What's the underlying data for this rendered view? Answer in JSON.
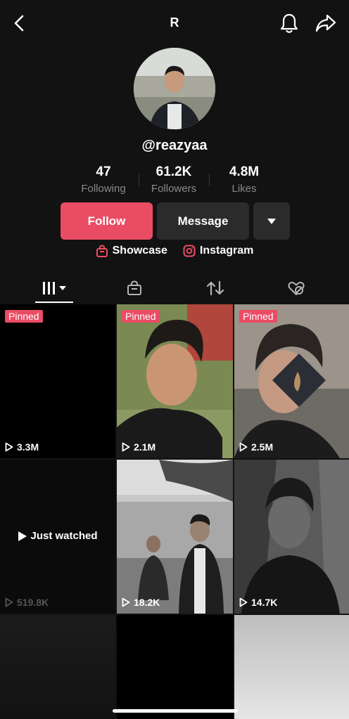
{
  "header": {
    "title": "R"
  },
  "profile": {
    "handle": "@reazyaa",
    "stats": [
      {
        "value": "47",
        "label": "Following"
      },
      {
        "value": "61.2K",
        "label": "Followers"
      },
      {
        "value": "4.8M",
        "label": "Likes"
      }
    ]
  },
  "actions": {
    "follow": "Follow",
    "message": "Message"
  },
  "links": {
    "showcase": "Showcase",
    "instagram": "Instagram"
  },
  "colors": {
    "accent": "#ea4c64",
    "background": "#121212"
  },
  "tabs": [
    "videos-grid",
    "shop-bag",
    "reposts",
    "liked-hidden"
  ],
  "videos": [
    {
      "pinned": "Pinned",
      "views": "3.3M"
    },
    {
      "pinned": "Pinned",
      "views": "2.1M"
    },
    {
      "pinned": "Pinned",
      "views": "2.5M"
    },
    {
      "overlay": "Just watched",
      "views": "519.8K"
    },
    {
      "views": "18.2K"
    },
    {
      "views": "14.7K"
    }
  ]
}
